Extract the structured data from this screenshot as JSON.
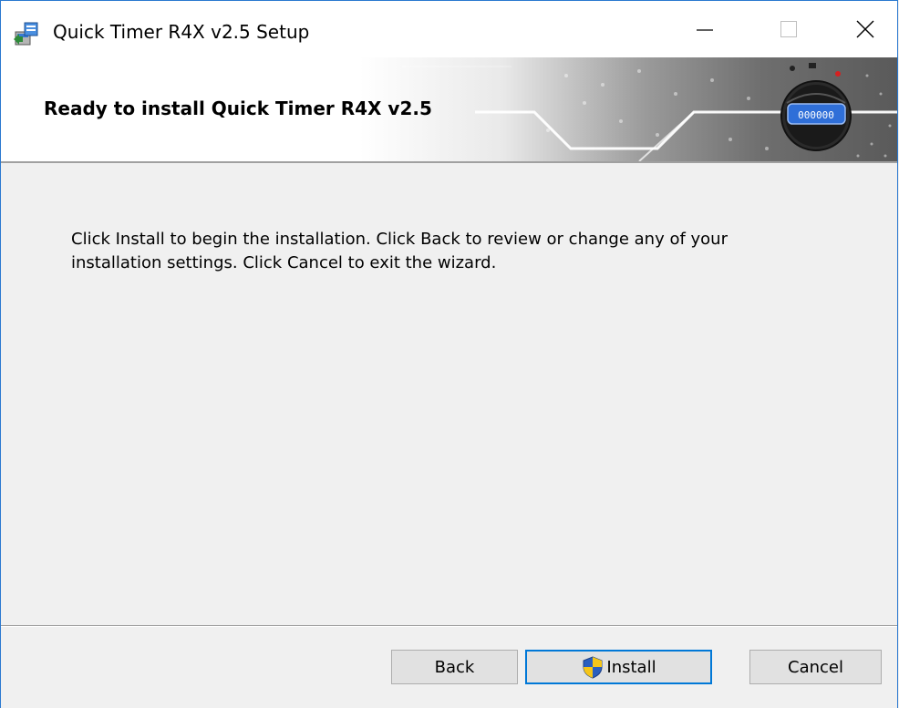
{
  "window": {
    "title": "Quick Timer R4X v2.5 Setup",
    "icons": {
      "app": "installer-icon",
      "minimize": "minimize-icon",
      "maximize": "maximize-icon",
      "close": "close-icon"
    }
  },
  "banner": {
    "title": "Ready to install Quick Timer R4X v2.5",
    "image": "stopwatch-icon"
  },
  "body": {
    "message_line1": "Click Install to begin the installation. Click Back to review or change any of your",
    "message_line2": "installation settings. Click Cancel to exit the wizard."
  },
  "buttons": {
    "back": "Back",
    "install": "Install",
    "cancel": "Cancel",
    "install_icon": "uac-shield-icon"
  },
  "colors": {
    "accent": "#0078d7",
    "window_border": "#2b79d0",
    "background": "#f0f0f0"
  }
}
